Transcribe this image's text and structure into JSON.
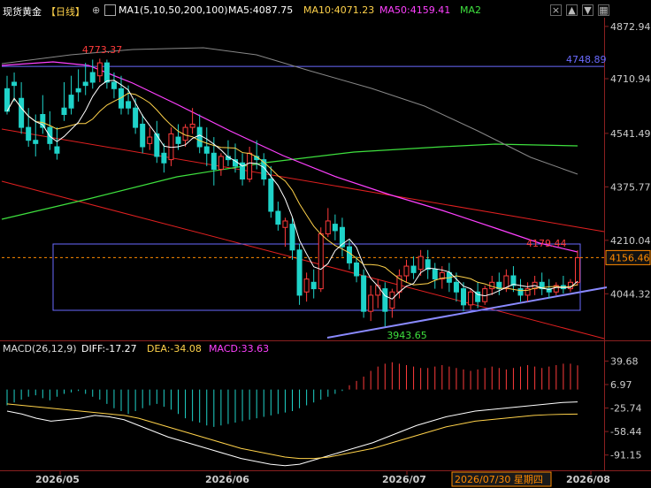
{
  "header": {
    "instrument": "现货黄金",
    "period": "【日线】",
    "ma_label": "MA1(5,10,50,200,100)",
    "ma5": "MA5:4087.75",
    "ma10": "MA10:4071.23",
    "ma50": "MA50:4159.41",
    "ma2": "MA2"
  },
  "macd_header": {
    "label": "MACD(26,12,9)",
    "diff": "DIFF:-17.27",
    "dea": "DEA:-34.08",
    "macd": "MACD:33.63"
  },
  "price_axis": [
    "4872.94",
    "4710.94",
    "4541.49",
    "4375.77",
    "4210.04",
    "4044.32"
  ],
  "macd_axis": [
    "39.68",
    "6.97",
    "-25.74",
    "-58.44",
    "-91.15"
  ],
  "time_axis": [
    "2026/05",
    "2026/06",
    "2026/07",
    "2026/08"
  ],
  "cursor_label": "2026/07/30 星期四",
  "annotations": {
    "high": "4773.37",
    "low": "3943.65",
    "resistance": "4748.89",
    "recent": "4179.44",
    "current": "4156.46"
  },
  "colors": {
    "up": "#ff3b3b",
    "down": "#1fd3c9",
    "ma5": "#ffffff",
    "ma10": "#ffd24a",
    "ma50": "#ff40ff",
    "ma100": "#888888",
    "ma200": "#3ee03e",
    "box": "#6a6aff",
    "support": "#8a8aff"
  },
  "chart_data": {
    "type": "candlestick",
    "x": [
      "2026/05",
      "2026/06",
      "2026/07",
      "2026/08"
    ],
    "ylim": [
      3900,
      4900
    ],
    "candles": [
      [
        4680,
        4720,
        4610,
        4600
      ],
      [
        4700,
        4730,
        4690,
        4640
      ],
      [
        4650,
        4700,
        4560,
        4540
      ],
      [
        4560,
        4620,
        4520,
        4500
      ],
      [
        4520,
        4600,
        4510,
        4470
      ],
      [
        4600,
        4660,
        4560,
        4540
      ],
      [
        4560,
        4610,
        4510,
        4490
      ],
      [
        4500,
        4560,
        4480,
        4460
      ],
      [
        4620,
        4700,
        4600,
        4580
      ],
      [
        4660,
        4720,
        4620,
        4600
      ],
      [
        4680,
        4740,
        4670,
        4640
      ],
      [
        4700,
        4760,
        4690,
        4660
      ],
      [
        4730,
        4770,
        4700,
        4680
      ],
      [
        4720,
        4773,
        4760,
        4700
      ],
      [
        4760,
        4770,
        4700,
        4680
      ],
      [
        4700,
        4730,
        4680,
        4650
      ],
      [
        4680,
        4720,
        4620,
        4600
      ],
      [
        4640,
        4690,
        4620,
        4600
      ],
      [
        4620,
        4650,
        4560,
        4540
      ],
      [
        4570,
        4600,
        4500,
        4480
      ],
      [
        4510,
        4560,
        4530,
        4490
      ],
      [
        4540,
        4580,
        4470,
        4450
      ],
      [
        4480,
        4510,
        4450,
        4420
      ],
      [
        4460,
        4560,
        4540,
        4440
      ],
      [
        4530,
        4570,
        4510,
        4490
      ],
      [
        4520,
        4570,
        4560,
        4500
      ],
      [
        4560,
        4620,
        4570,
        4540
      ],
      [
        4560,
        4600,
        4500,
        4480
      ],
      [
        4500,
        4560,
        4480,
        4440
      ],
      [
        4480,
        4530,
        4430,
        4380
      ],
      [
        4430,
        4480,
        4470,
        4410
      ],
      [
        4470,
        4520,
        4460,
        4440
      ],
      [
        4460,
        4510,
        4440,
        4420
      ],
      [
        4450,
        4480,
        4400,
        4380
      ],
      [
        4400,
        4500,
        4480,
        4390
      ],
      [
        4470,
        4520,
        4460,
        4430
      ],
      [
        4460,
        4480,
        4400,
        4380
      ],
      [
        4400,
        4440,
        4300,
        4280
      ],
      [
        4300,
        4330,
        4260,
        4240
      ],
      [
        4250,
        4280,
        4270,
        4190
      ],
      [
        4260,
        4280,
        4180,
        4150
      ],
      [
        4180,
        4200,
        4040,
        4010
      ],
      [
        4050,
        4110,
        4090,
        4020
      ],
      [
        4080,
        4120,
        4060,
        4030
      ],
      [
        4060,
        4250,
        4230,
        4050
      ],
      [
        4230,
        4310,
        4270,
        4220
      ],
      [
        4260,
        4290,
        4240,
        4210
      ],
      [
        4250,
        4280,
        4190,
        4160
      ],
      [
        4190,
        4210,
        4140,
        4120
      ],
      [
        4140,
        4160,
        4100,
        4080
      ],
      [
        4100,
        4120,
        3990,
        3970
      ],
      [
        3990,
        4070,
        4040,
        3960
      ],
      [
        4040,
        4090,
        4070,
        4000
      ],
      [
        4060,
        4080,
        3990,
        3943
      ],
      [
        4000,
        4060,
        4050,
        3970
      ],
      [
        4050,
        4120,
        4100,
        4030
      ],
      [
        4100,
        4150,
        4130,
        4080
      ],
      [
        4130,
        4160,
        4110,
        4090
      ],
      [
        4120,
        4180,
        4160,
        4100
      ],
      [
        4150,
        4180,
        4120,
        4090
      ],
      [
        4120,
        4140,
        4090,
        4060
      ],
      [
        4090,
        4130,
        4110,
        4060
      ],
      [
        4110,
        4140,
        4080,
        4050
      ],
      [
        4080,
        4110,
        4050,
        4020
      ],
      [
        4060,
        4080,
        4010,
        3990
      ],
      [
        4010,
        4060,
        4050,
        3995
      ],
      [
        4050,
        4080,
        4020,
        4000
      ],
      [
        4020,
        4070,
        4060,
        4010
      ],
      [
        4060,
        4100,
        4080,
        4040
      ],
      [
        4080,
        4110,
        4060,
        4040
      ],
      [
        4060,
        4120,
        4100,
        4050
      ],
      [
        4100,
        4130,
        4070,
        4050
      ],
      [
        4060,
        4090,
        4040,
        4020
      ],
      [
        4040,
        4080,
        4060,
        4020
      ],
      [
        4060,
        4100,
        4080,
        4040
      ],
      [
        4080,
        4110,
        4060,
        4040
      ],
      [
        4060,
        4090,
        4050,
        4030
      ],
      [
        4050,
        4080,
        4070,
        4040
      ],
      [
        4070,
        4100,
        4060,
        4045
      ],
      [
        4060,
        4090,
        4080,
        4050
      ],
      [
        4080,
        4179,
        4156,
        4070
      ]
    ],
    "macd_hist": [
      -22,
      -18,
      -14,
      -10,
      -8,
      -12,
      -15,
      -10,
      -6,
      -4,
      -2,
      -6,
      -10,
      -14,
      -20,
      -26,
      -30,
      -34,
      -30,
      -26,
      -22,
      -20,
      -24,
      -28,
      -34,
      -40,
      -44,
      -46,
      -50,
      -52,
      -50,
      -48,
      -46,
      -44,
      -42,
      -40,
      -38,
      -36,
      -34,
      -32,
      -30,
      -26,
      -22,
      -18,
      -14,
      -10,
      -6,
      -2,
      6,
      12,
      18,
      26,
      32,
      36,
      38,
      36,
      34,
      32,
      30,
      30,
      32,
      34,
      32,
      30,
      28,
      26,
      28,
      30,
      32,
      30,
      28,
      30,
      32,
      34,
      32,
      30,
      32,
      34,
      36,
      36,
      33.63
    ],
    "diff_line": [
      -30,
      -34,
      -40,
      -44,
      -42,
      -40,
      -36,
      -38,
      -42,
      -50,
      -58,
      -66,
      -72,
      -78,
      -84,
      -90,
      -96,
      -100,
      -104,
      -106,
      -104,
      -98,
      -92,
      -86,
      -80,
      -74,
      -66,
      -58,
      -50,
      -44,
      -38,
      -34,
      -30,
      -28,
      -26,
      -24,
      -22,
      -20,
      -18,
      -17.27
    ],
    "dea_line": [
      -20,
      -22,
      -24,
      -26,
      -28,
      -30,
      -32,
      -34,
      -36,
      -40,
      -46,
      -52,
      -58,
      -64,
      -70,
      -76,
      -82,
      -86,
      -90,
      -94,
      -96,
      -96,
      -94,
      -90,
      -86,
      -82,
      -76,
      -70,
      -64,
      -58,
      -52,
      -48,
      -44,
      -42,
      -40,
      -38,
      -36,
      -35,
      -34.5,
      -34.08
    ]
  }
}
